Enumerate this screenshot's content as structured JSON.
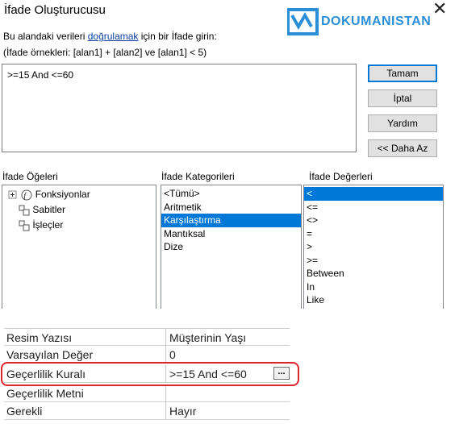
{
  "dialog": {
    "title": "İfade Oluşturucusu",
    "instruction_prefix": "Bu alandaki verileri ",
    "instruction_link": "doğrulamak",
    "instruction_suffix": " için bir İfade girin:",
    "examples": "(İfade örnekleri: [alan1] + [alan2] ve [alan1] < 5)",
    "expression": ">=15 And <=60"
  },
  "logo": {
    "text": "DOKUMANISTAN"
  },
  "buttons": {
    "ok": "Tamam",
    "cancel": "İptal",
    "help": "Yardım",
    "less": "<< Daha Az"
  },
  "panels": {
    "elements_label": "İfade Öğeleri",
    "categories_label": "İfade Kategorileri",
    "values_label": "İfade Değerleri",
    "elements": [
      "Fonksiyonlar",
      "Sabitler",
      "İşleçler"
    ],
    "categories": [
      "<Tümü>",
      "Aritmetik",
      "Karşılaştırma",
      "Mantıksal",
      "Dize"
    ],
    "selected_category": "Karşılaştırma",
    "values": [
      "<",
      "<=",
      "<>",
      "=",
      ">",
      ">=",
      "Between",
      "In",
      "Like"
    ],
    "selected_value": "<"
  },
  "properties": [
    {
      "label": "Resim Yazısı",
      "value": "Müşterinin Yaşı"
    },
    {
      "label": "Varsayılan Değer",
      "value": "0"
    },
    {
      "label": "Geçerlilik Kuralı",
      "value": ">=15 And <=60"
    },
    {
      "label": "Geçerlilik Metni",
      "value": ""
    },
    {
      "label": "Gerekli",
      "value": "Hayır"
    }
  ],
  "builder_button_label": "...",
  "colors": {
    "selection": "#0078d7",
    "highlight": "#e0242b",
    "link": "#0d3f9c",
    "logo": "#2a8fd6"
  }
}
